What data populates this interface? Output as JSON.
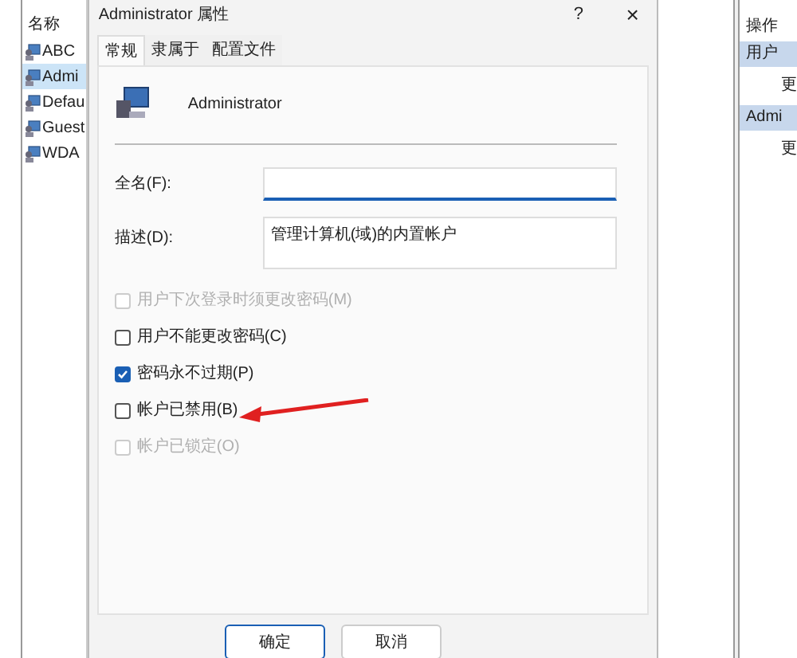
{
  "list_pane": {
    "header": "名称",
    "items": [
      {
        "label": "ABC",
        "selected": false
      },
      {
        "label": "Admi",
        "selected": true
      },
      {
        "label": "Defau",
        "selected": false
      },
      {
        "label": "Guest",
        "selected": false
      },
      {
        "label": "WDA",
        "selected": false
      }
    ]
  },
  "dialog": {
    "title": "Administrator 属性",
    "help": "?",
    "close": "×",
    "tabs": [
      {
        "label": "常规",
        "selected": true
      },
      {
        "label": "隶属于",
        "selected": false
      },
      {
        "label": "配置文件",
        "selected": false
      }
    ],
    "user_name": "Administrator",
    "full_name": {
      "label": "全名(F):"
    },
    "description": {
      "label": "描述(D):",
      "value": "管理计算机(域)的内置帐户"
    },
    "options": [
      {
        "label": "用户下次登录时须更改密码(M)",
        "checked": false,
        "disabled": true
      },
      {
        "label": "用户不能更改密码(C)",
        "checked": false,
        "disabled": false
      },
      {
        "label": "密码永不过期(P)",
        "checked": true,
        "disabled": false
      },
      {
        "label": "帐户已禁用(B)",
        "checked": false,
        "disabled": false
      },
      {
        "label": "帐户已锁定(O)",
        "checked": false,
        "disabled": true
      }
    ],
    "buttons": [
      "确定",
      "取消"
    ]
  },
  "actions_pane": {
    "header": "操作",
    "sections": [
      {
        "title": "用户",
        "item": "更"
      },
      {
        "title": "Admi",
        "item": "更"
      }
    ]
  }
}
